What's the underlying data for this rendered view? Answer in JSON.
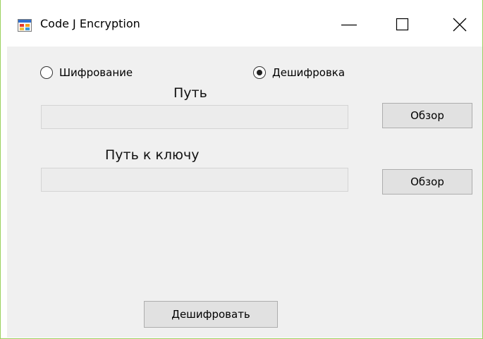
{
  "window": {
    "title": "Code J Encryption",
    "icon": "app-form-icon",
    "controls": [
      "minimize-icon",
      "maximize-icon",
      "close-icon"
    ]
  },
  "mode": {
    "options": [
      {
        "label": "Шифрование",
        "selected": false
      },
      {
        "label": "Дешифровка",
        "selected": true
      }
    ]
  },
  "path": {
    "label": "Путь",
    "value": "",
    "browse_label": "Обзор"
  },
  "key_path": {
    "label": "Путь к ключу",
    "value": "",
    "browse_label": "Обзор"
  },
  "action": {
    "label": "Дешифровать"
  },
  "colors": {
    "window_border": "#9bd15f",
    "client_background": "#f0f0f0",
    "button_background": "#e1e1e1"
  }
}
